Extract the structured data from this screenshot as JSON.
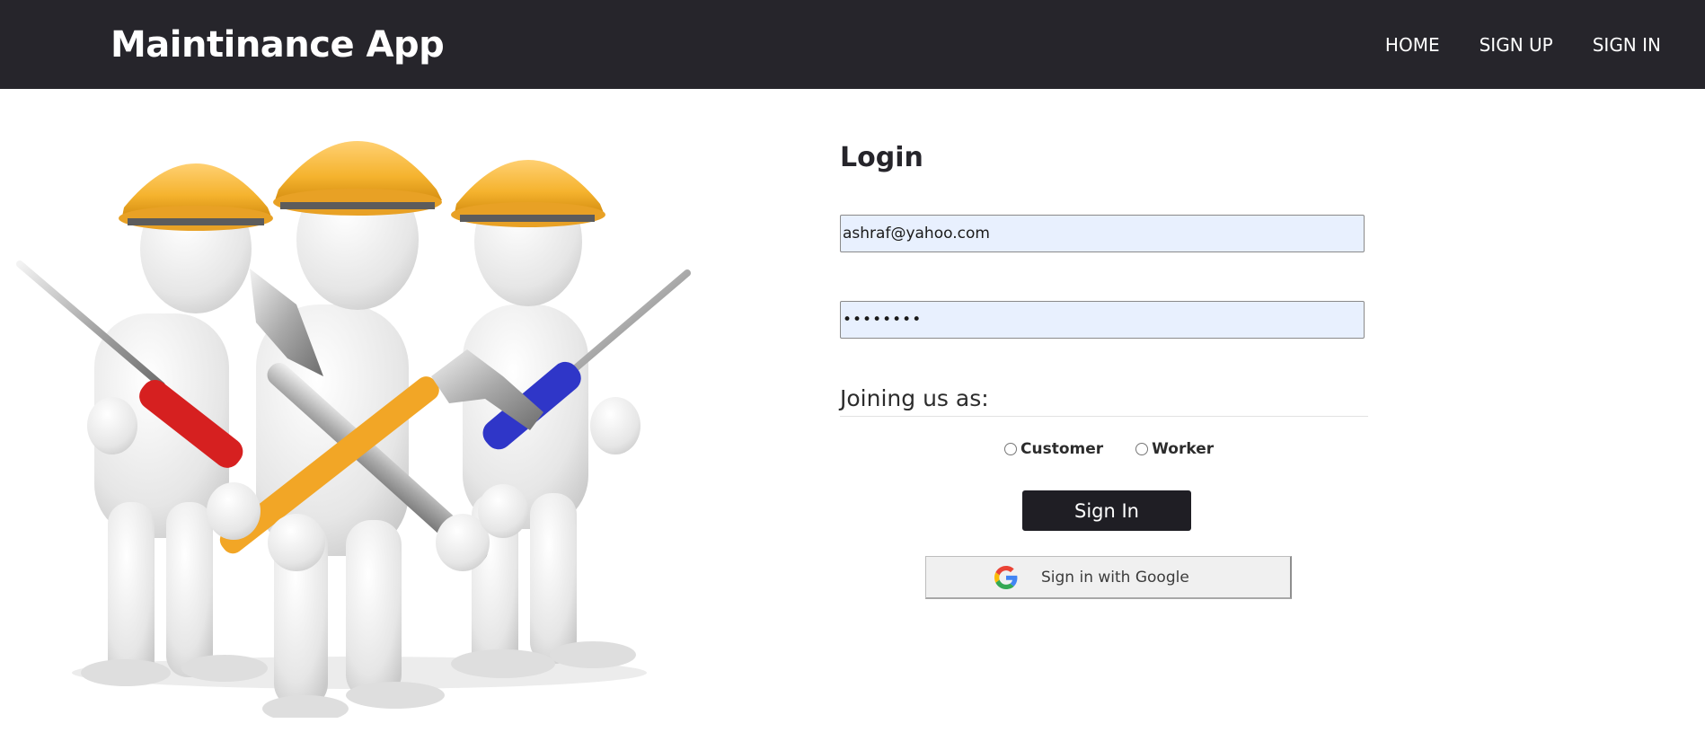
{
  "navbar": {
    "brand": "Maintinance App",
    "links": [
      {
        "label": "HOME"
      },
      {
        "label": "SIGN UP"
      },
      {
        "label": "SIGN IN"
      }
    ]
  },
  "hero": {
    "image": "three-workers-with-hard-hats-and-tools"
  },
  "login": {
    "title": "Login",
    "email_value": "ashraf@yahoo.com",
    "password_value": "••••••••",
    "joining_label": "Joining us as:",
    "roles": [
      {
        "label": "Customer"
      },
      {
        "label": "Worker"
      }
    ],
    "signin_label": "Sign In",
    "google_label": "Sign in with Google"
  },
  "colors": {
    "navbar_bg": "#26252b",
    "input_bg": "#e8f0fe",
    "button_bg": "#1f1e24",
    "hard_hat": "#f5b32e"
  }
}
